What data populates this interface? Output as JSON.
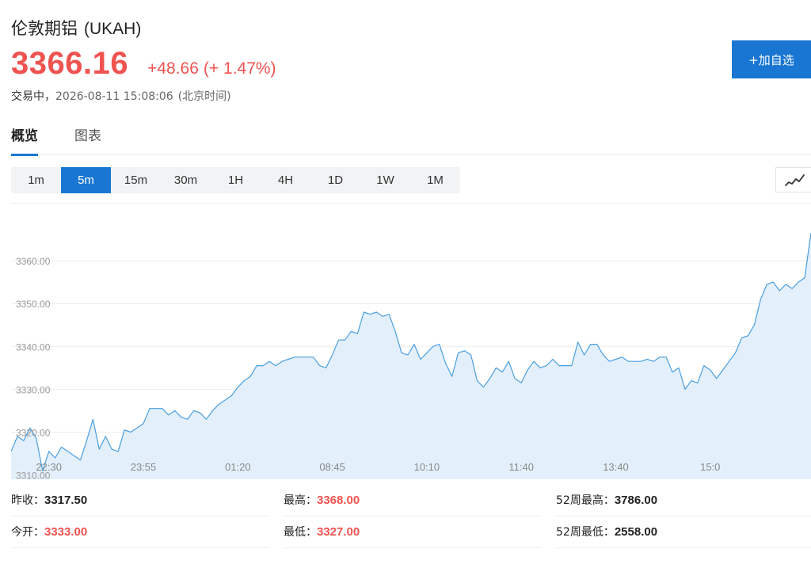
{
  "header": {
    "name": "伦敦期铝",
    "code": "(UKAH)",
    "price": "3366.16",
    "change": "+48.66",
    "change_pct": "(+ 1.47%)",
    "status": "交易中，",
    "datetime": "2026-08-11 15:08:06",
    "timezone": "(北京时间)",
    "add_button": "+加自选"
  },
  "tabs": [
    {
      "label": "概览",
      "active": true
    },
    {
      "label": "图表",
      "active": false
    }
  ],
  "intervals": [
    {
      "label": "1m",
      "active": false
    },
    {
      "label": "5m",
      "active": true
    },
    {
      "label": "15m",
      "active": false
    },
    {
      "label": "30m",
      "active": false
    },
    {
      "label": "1H",
      "active": false
    },
    {
      "label": "4H",
      "active": false
    },
    {
      "label": "1D",
      "active": false
    },
    {
      "label": "1W",
      "active": false
    },
    {
      "label": "1M",
      "active": false
    }
  ],
  "chart_type_icon": "line-chart-icon",
  "colors": {
    "up": "#ef5350",
    "accent": "#1976d2",
    "line": "#4a9fe0",
    "area": "#e3f0fc"
  },
  "chart_data": {
    "type": "area",
    "ylim": [
      3309,
      3370
    ],
    "y_ticks": [
      3310,
      3320,
      3330,
      3340,
      3350,
      3360
    ],
    "y_tick_labels": [
      "3310.00",
      "3320.00",
      "3330.00",
      "3340.00",
      "3350.00",
      "3360.00"
    ],
    "x_tick_labels": [
      "22:30",
      "23:55",
      "01:20",
      "08:45",
      "10:10",
      "11:40",
      "13:40",
      "15:0"
    ],
    "x_tick_index": [
      6,
      21,
      36,
      51,
      66,
      81,
      96,
      111
    ],
    "grid": true,
    "series": [
      {
        "values": [
          3315.5,
          3319.0,
          3318.0,
          3321.0,
          3318.5,
          3311.0,
          3315.5,
          3314.0,
          3316.5,
          3315.5,
          3314.5,
          3313.5,
          3318.0,
          3323.0,
          3316.0,
          3319.0,
          3316.0,
          3315.5,
          3320.5,
          3320.0,
          3321.0,
          3322.0,
          3325.5,
          3325.5,
          3325.5,
          3324.0,
          3325.0,
          3323.5,
          3323.0,
          3325.0,
          3324.5,
          3323.0,
          3325.0,
          3326.5,
          3327.5,
          3328.5,
          3330.5,
          3332.0,
          3333.0,
          3335.5,
          3335.5,
          3336.5,
          3335.5,
          3336.5,
          3337.0,
          3337.5,
          3337.5,
          3337.5,
          3337.5,
          3335.5,
          3335.0,
          3338.0,
          3341.5,
          3341.5,
          3343.5,
          3343.0,
          3348.0,
          3347.5,
          3348.0,
          3347.0,
          3347.5,
          3343.5,
          3338.5,
          3338.0,
          3340.5,
          3337.0,
          3338.5,
          3340.0,
          3340.5,
          3336.0,
          3333.0,
          3338.5,
          3339.0,
          3338.0,
          3332.0,
          3330.5,
          3332.5,
          3335.0,
          3334.0,
          3336.5,
          3332.5,
          3331.5,
          3334.5,
          3336.5,
          3335.0,
          3335.5,
          3337.0,
          3335.5,
          3335.5,
          3335.5,
          3341.0,
          3338.0,
          3340.5,
          3340.5,
          3338.0,
          3336.5,
          3337.0,
          3337.5,
          3336.5,
          3336.5,
          3336.5,
          3337.0,
          3336.5,
          3337.5,
          3337.5,
          3334.0,
          3335.0,
          3330.0,
          3332.0,
          3331.5,
          3335.5,
          3334.5,
          3332.5,
          3334.5,
          3336.5,
          3338.5,
          3342.0,
          3342.5,
          3345.0,
          3351.0,
          3354.5,
          3355.0,
          3353.0,
          3354.5,
          3353.5,
          3355.0,
          3356.0,
          3366.5
        ]
      }
    ]
  },
  "stats": [
    [
      {
        "label": "昨收：",
        "value": "3317.50",
        "red": false
      },
      {
        "label": "最高：",
        "value": "3368.00",
        "red": true
      },
      {
        "label": "52周最高：",
        "value": "3786.00",
        "red": false
      }
    ],
    [
      {
        "label": "今开：",
        "value": "3333.00",
        "red": true
      },
      {
        "label": "最低：",
        "value": "3327.00",
        "red": true
      },
      {
        "label": "52周最低：",
        "value": "2558.00",
        "red": false
      }
    ]
  ]
}
